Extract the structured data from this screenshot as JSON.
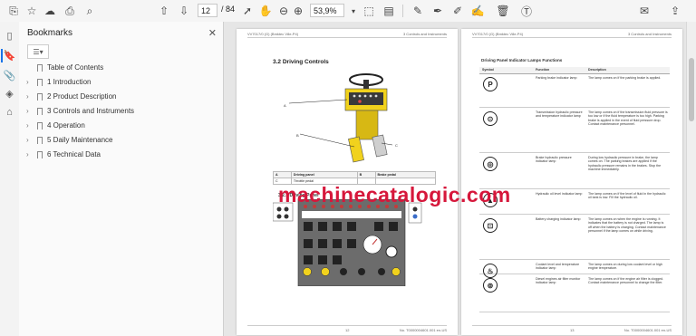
{
  "toolbar": {
    "page_current": "12",
    "page_total": "/ 84",
    "zoom": "53,9%"
  },
  "bookmarks": {
    "title": "Bookmarks",
    "items": [
      {
        "label": "Table of Contents",
        "expandable": false
      },
      {
        "label": "1 Introduction",
        "expandable": true
      },
      {
        "label": "2 Product Description",
        "expandable": true
      },
      {
        "label": "3 Controls and Instruments",
        "expandable": true
      },
      {
        "label": "4 Operation",
        "expandable": true
      },
      {
        "label": "5 Daily Maintenance",
        "expandable": true
      },
      {
        "label": "6 Technical Data",
        "expandable": true
      }
    ]
  },
  "page_left": {
    "header_left": "VV7017/0 (G) (Bmktec V8e-P4)",
    "header_right": "3 Controls and Instruments",
    "section": "3.2   Driving Controls",
    "callouts": [
      "A",
      "B",
      "C"
    ],
    "table": [
      [
        "A",
        "Driving panel",
        "B",
        "Brake pedal"
      ],
      [
        "C",
        "Throttle pedal",
        "",
        ""
      ]
    ],
    "subsection": "3.2.1  Driving Panel",
    "footer_left": "12",
    "footer_right": "No. T0000004601.001 en-US"
  },
  "page_right": {
    "header_left": "VV7017/0 (G) (Bmktec V8e-P4)",
    "header_right": "3 Controls and Instruments",
    "table_title": "Driving Panel Indicator Lamps Functions",
    "columns": [
      "Symbol",
      "Function",
      "Description"
    ],
    "rows": [
      {
        "function": "Parking brake indicator lamp",
        "description": "The lamp comes on if the parking brake is applied."
      },
      {
        "function": "Transmission hydraulic pressure and temperature indicator lamp",
        "description": "The lamp comes on if the transmission fluid pressure is too low or if the fluid temperature is too high. Parking brake is applied in the event of fluid pressure drop. Contact maintenance personnel."
      },
      {
        "function": "Brake hydraulic pressure indicator lamp",
        "description": "During low hydraulic pressure in brake, the lamp comes on. The parking brakes are applied if the hydraulic pressure remains in the brakes. Stop the machine immediately."
      },
      {
        "function": "Hydraulic oil level indicator lamp",
        "description": "The lamp comes on if the level of fluid in the hydraulic oil tank is low. Fill the hydraulic oil."
      },
      {
        "function": "Battery charging indicator lamp",
        "description": "The lamp comes on when the engine is running. It indicates that the battery is not charged. The lamp is off when the battery is charging. Contact maintenance personnel if the lamp comes on while driving."
      },
      {
        "function": "Coolant level and temperature indicator lamp",
        "description": "The lamp comes on during low coolant level or high engine temperature."
      },
      {
        "function": "Diesel engines air filter monitor indicator lamp",
        "description": "The lamp comes on if the engine air filter is clogged. Contact maintenance personnel to change the filter."
      }
    ],
    "footer_left": "13",
    "footer_right": "No. T0000004601.001 en-US"
  },
  "watermark": "machinecatalogic.com",
  "colors": {
    "accent": "#1a73e8",
    "watermark": "#d6173b",
    "panel_yellow": "#f1d21d"
  }
}
